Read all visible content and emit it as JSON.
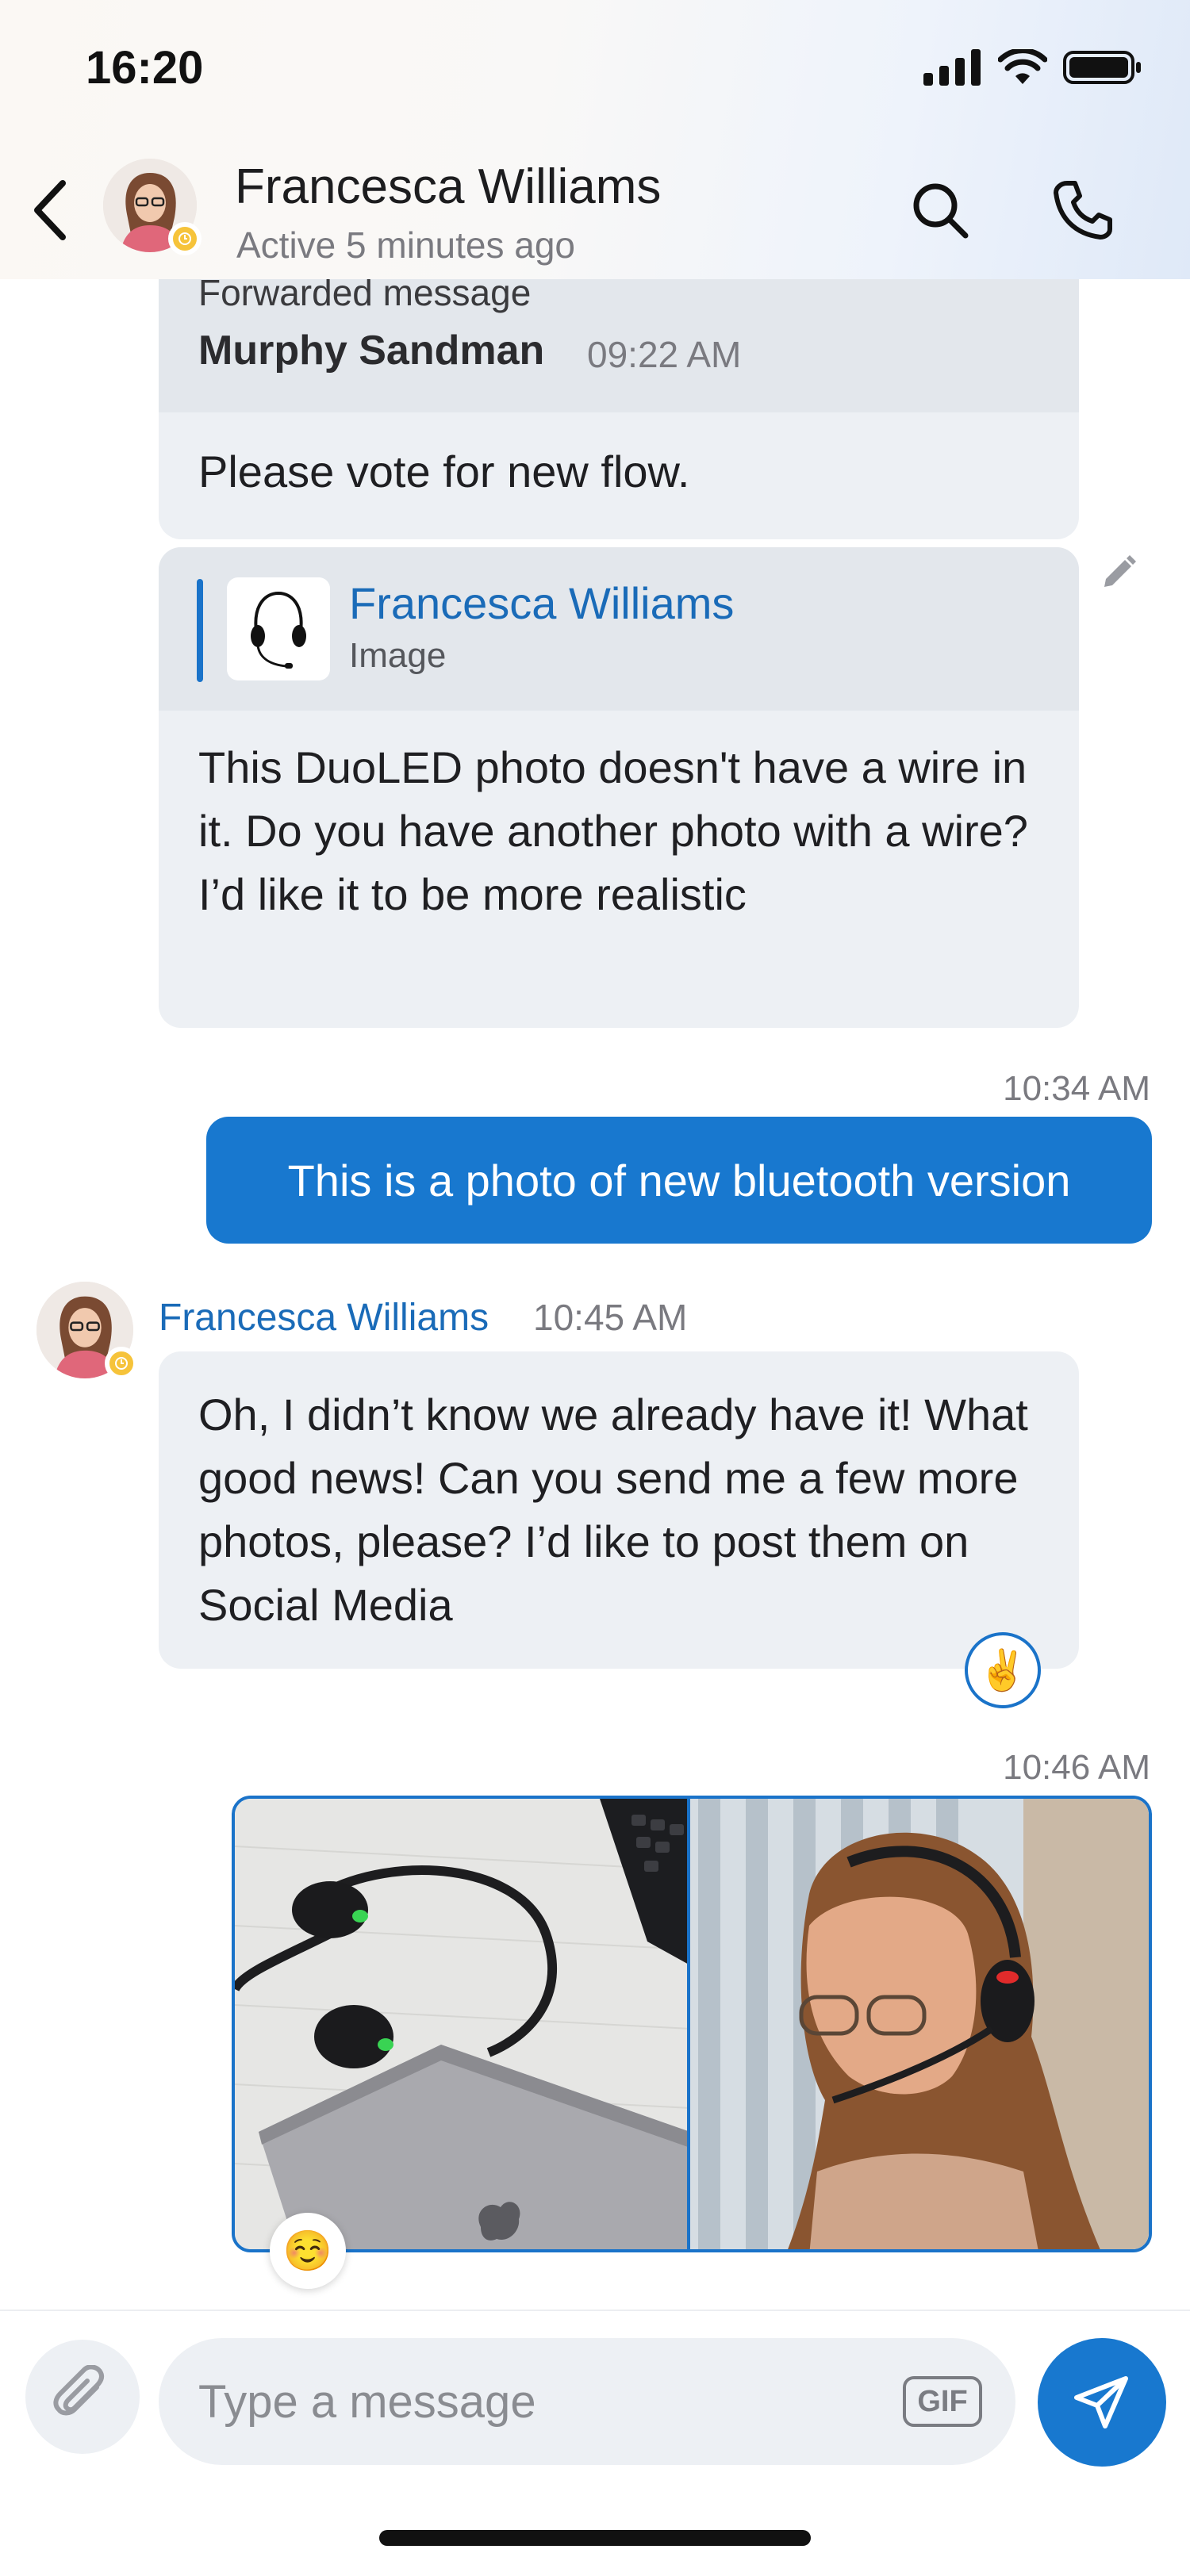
{
  "status_bar": {
    "time": "16:20"
  },
  "header": {
    "name": "Francesca Williams",
    "status": "Active 5 minutes ago"
  },
  "messages": {
    "forwarded": {
      "label": "Forwarded message",
      "author": "Murphy Sandman",
      "time": "09:22 AM",
      "text": "Please vote for new flow."
    },
    "reply": {
      "quote_author": "Francesca Williams",
      "quote_type": "Image",
      "text": "This DuoLED photo doesn't have a wire in it. Do you have another photo with a wire? I’d like it to be more realistic"
    },
    "outgoing_time": "10:34 AM",
    "outgoing_text": "This is a photo of new bluetooth version",
    "incoming": {
      "sender": "Francesca Williams",
      "time": "10:45 AM",
      "text": "Oh, I didn’t know we already have it! What good news! Can you send me a few more photos, please? I’d like to post them on Social Media",
      "reaction": "✌️"
    },
    "gallery": {
      "time": "10:46 AM",
      "reaction": "☺️"
    }
  },
  "composer": {
    "placeholder": "Type a message",
    "gif_label": "GIF"
  },
  "colors": {
    "accent": "#1878cf",
    "bubble_in": "#edf0f4",
    "status_away": "#f6c33a"
  }
}
